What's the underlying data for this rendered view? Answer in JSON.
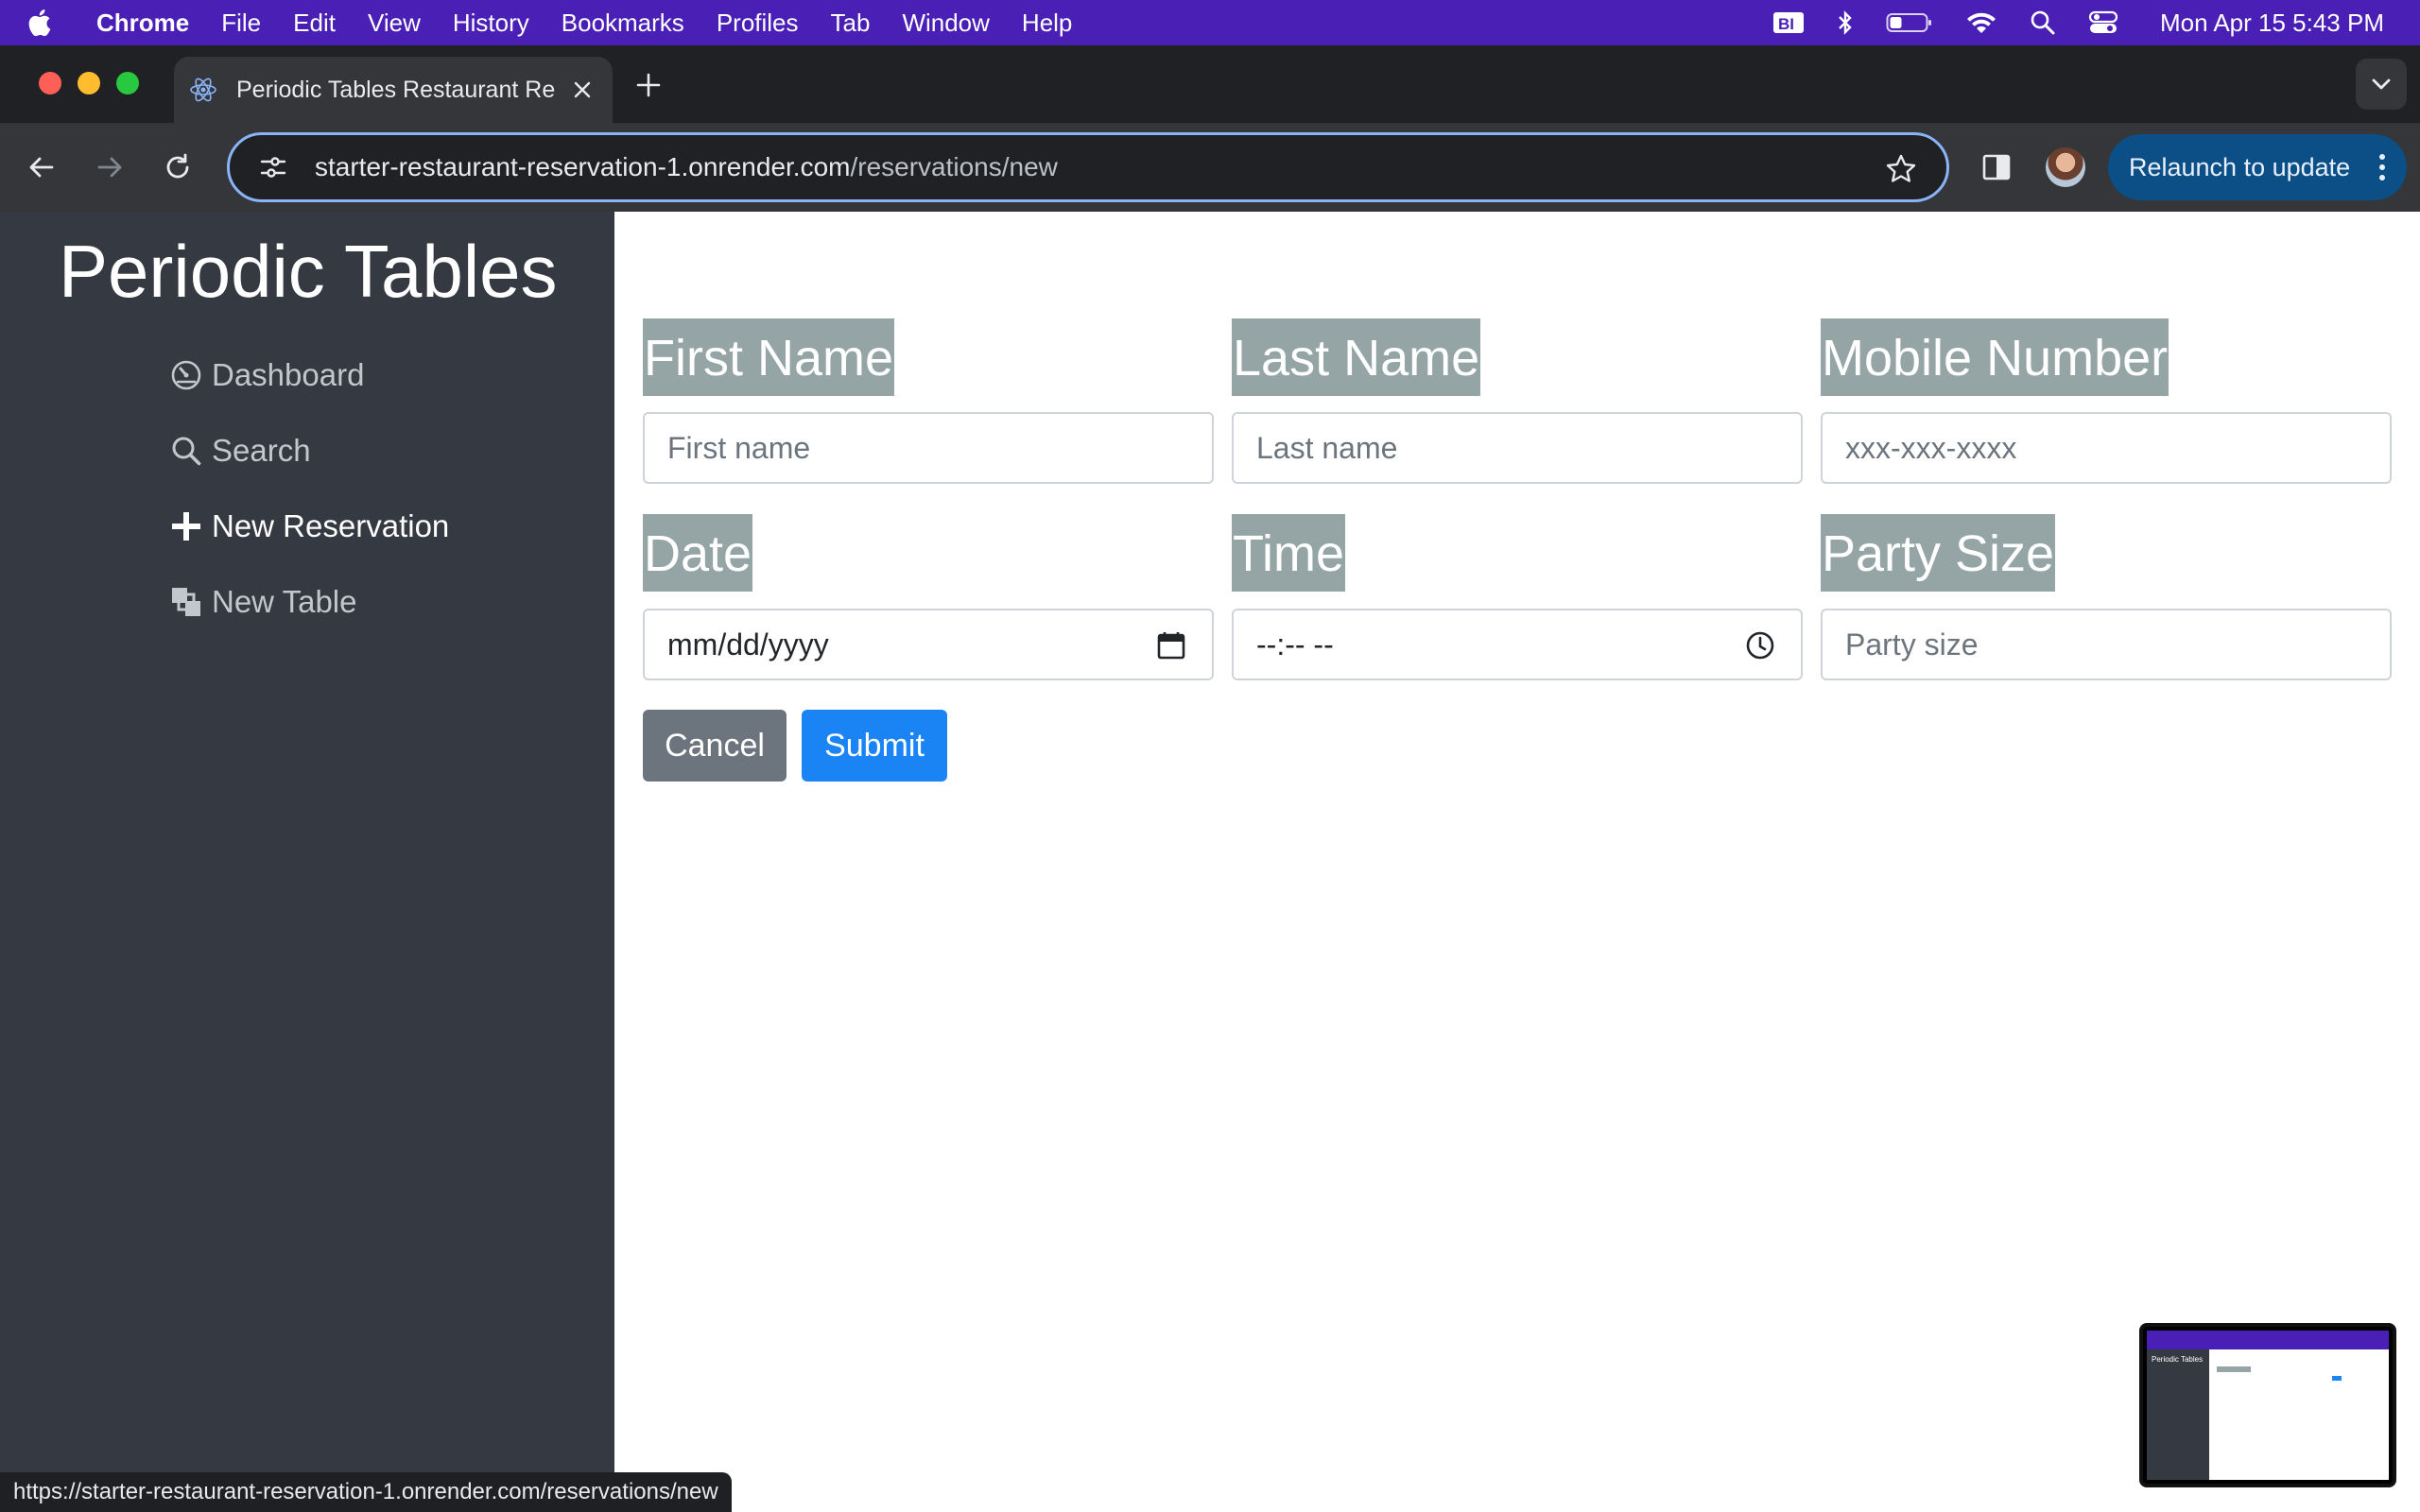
{
  "menubar": {
    "app": "Chrome",
    "items": [
      "File",
      "Edit",
      "View",
      "History",
      "Bookmarks",
      "Profiles",
      "Tab",
      "Window",
      "Help"
    ],
    "clock": "Mon Apr 15  5:43 PM",
    "status_icons": [
      "bi-icon",
      "bluetooth-icon",
      "battery-icon",
      "wifi-icon",
      "spotlight-search-icon",
      "control-center-icon"
    ]
  },
  "browser": {
    "tab_title": "Periodic Tables Restaurant Re",
    "url_host": "starter-restaurant-reservation-1.onrender.com",
    "url_path": "/reservations/new",
    "relaunch_label": "Relaunch to update",
    "status_url": "https://starter-restaurant-reservation-1.onrender.com/reservations/new"
  },
  "sidebar": {
    "brand": "Periodic Tables",
    "items": [
      {
        "label": "Dashboard",
        "icon": "dashboard-icon"
      },
      {
        "label": "Search",
        "icon": "search-icon"
      },
      {
        "label": "New Reservation",
        "icon": "plus-icon"
      },
      {
        "label": "New Table",
        "icon": "layers-icon"
      }
    ]
  },
  "form": {
    "fields": [
      {
        "label": "First Name",
        "placeholder": "First name"
      },
      {
        "label": "Last Name",
        "placeholder": "Last name"
      },
      {
        "label": "Mobile Number",
        "placeholder": "xxx-xxx-xxxx"
      },
      {
        "label": "Date",
        "placeholder": "mm/dd/yyyy"
      },
      {
        "label": "Time",
        "placeholder": "--:-- --"
      },
      {
        "label": "Party Size",
        "placeholder": "Party size"
      }
    ],
    "cancel_label": "Cancel",
    "submit_label": "Submit"
  },
  "thumbnail": {
    "title": "Periodic Tables"
  },
  "colors": {
    "menubar": "#4a1fb6",
    "sidebar": "#353941",
    "label_bg": "#95a5a6",
    "cancel": "#6c757d",
    "submit": "#1a84f5",
    "relaunch": "#0b4f86"
  }
}
